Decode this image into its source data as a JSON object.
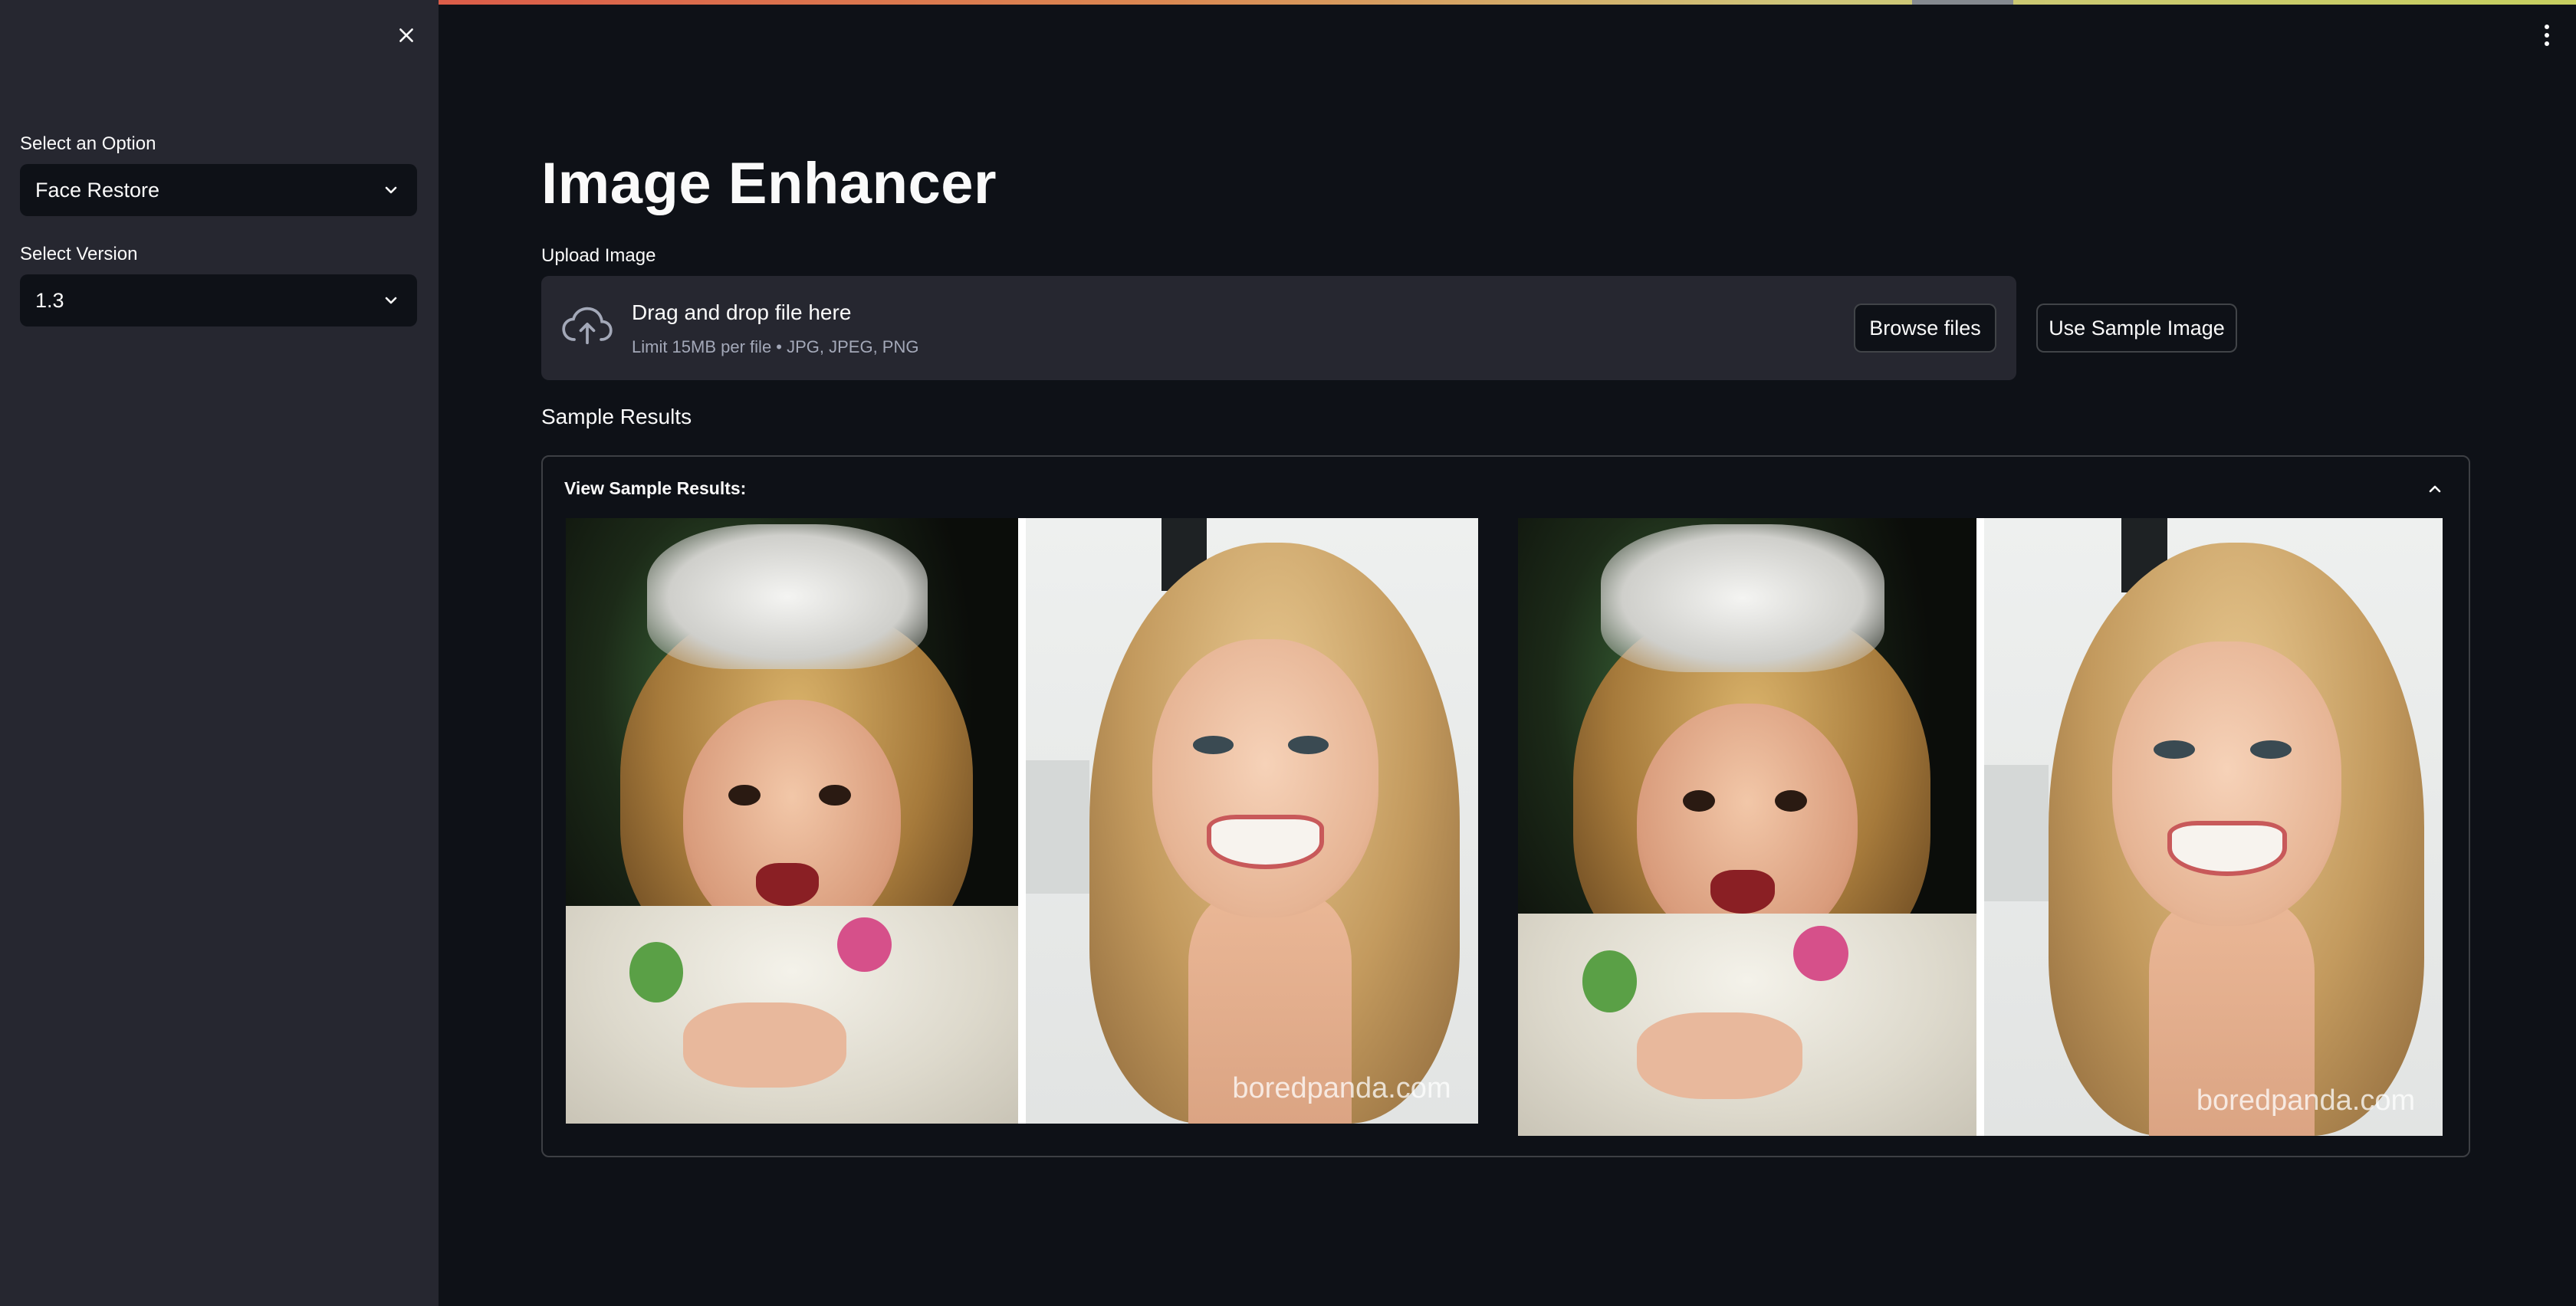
{
  "sidebar": {
    "option_label": "Select an Option",
    "option_value": "Face Restore",
    "version_label": "Select Version",
    "version_value": "1.3"
  },
  "main": {
    "title": "Image Enhancer",
    "upload_label": "Upload Image",
    "dropzone": {
      "title": "Drag and drop file here",
      "subtitle": "Limit 15MB per file • JPG, JPEG, PNG",
      "browse_label": "Browse files"
    },
    "sample_button_label": "Use Sample Image",
    "results_heading": "Sample Results",
    "expander_label": "View Sample Results:",
    "images": [
      {
        "name": "before",
        "watermark": "boredpanda.com"
      },
      {
        "name": "after",
        "watermark": "boredpanda.com"
      }
    ]
  },
  "colors": {
    "background": "#0e1117",
    "sidebar": "#262730",
    "text": "#fafafa",
    "accent": "#ff4b4b"
  },
  "icons": [
    "close-icon",
    "chevron-down-icon",
    "cloud-upload-icon",
    "chevron-up-icon",
    "more-vertical-icon"
  ]
}
